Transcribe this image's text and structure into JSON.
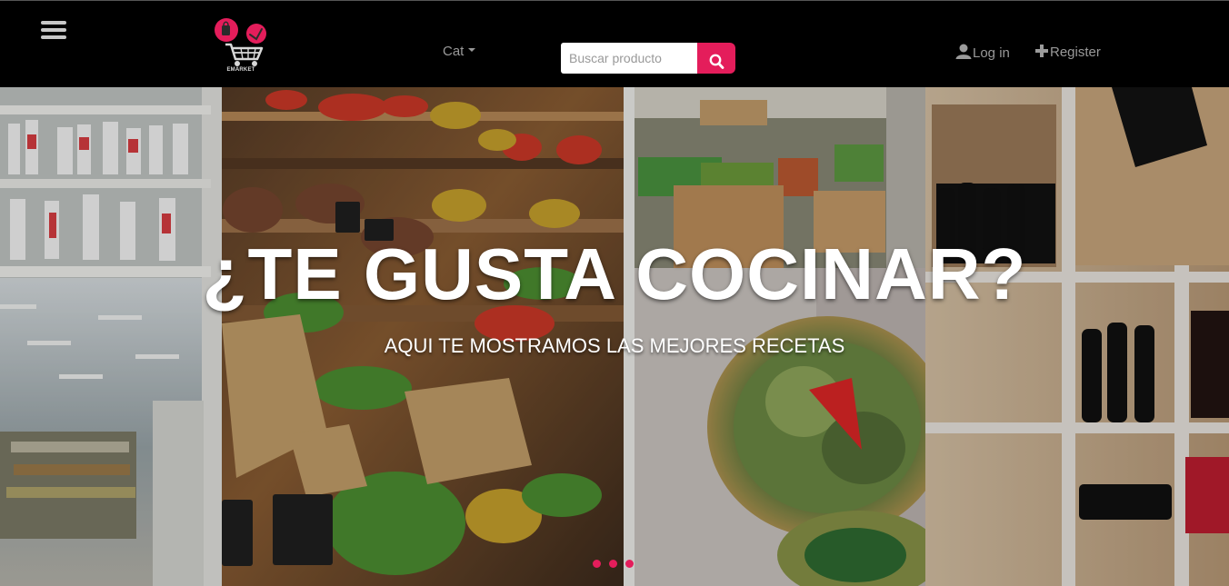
{
  "navbar": {
    "logo_text": "EMARKET",
    "category_dropdown": "Cat",
    "search": {
      "placeholder": "Buscar producto",
      "value": ""
    },
    "login_label": "Log in",
    "register_label": "Register"
  },
  "hero": {
    "title": "¿TE GUSTA COCINAR?",
    "subtitle": "AQUI TE MOSTRAMOS LAS MEJORES RECETAS"
  },
  "colors": {
    "navbar_background": "#000000",
    "accent": "#e41d5b",
    "nav_text": "#999999",
    "hero_text": "#ffffff"
  },
  "icons": {
    "menu": "hamburger-menu-icon",
    "logo_bag": "shopping-bag-icon",
    "logo_cart": "shopping-cart-icon",
    "search": "search-icon",
    "user": "user-icon",
    "register": "plus-icon"
  },
  "carousel": {
    "slide_count": 3,
    "active_slide": 1
  }
}
